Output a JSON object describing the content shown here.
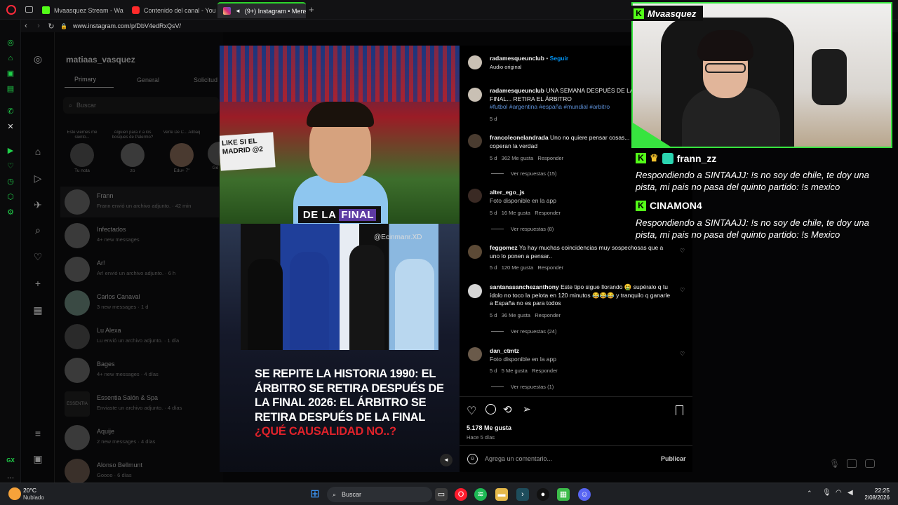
{
  "browser": {
    "tabs": [
      {
        "label": "Mvaasquez Stream - Watc",
        "color": "#53fc18"
      },
      {
        "label": "Contenido del canal - YouT",
        "color": "#ff2a2a"
      },
      {
        "label": "(9+) Instagram • Mens",
        "color": "#d6249f",
        "active": true
      }
    ],
    "url": "www.instagram.com/p/DbV4edRxQsV/",
    "new_tab": "+"
  },
  "inbox": {
    "username": "matiaas_vasquez",
    "tabs": [
      "Primary",
      "General",
      "Solicitud"
    ],
    "search_placeholder": "Buscar",
    "notes": [
      {
        "note": "Este viernes me siento...",
        "name": "Tu nota"
      },
      {
        "note": "Alguien para ir a los bosques de Palermo?",
        "name": "zo"
      },
      {
        "note": "Verte De C... Aitbaq",
        "name": "Edu+ 7\""
      },
      {
        "note": "",
        "name": "Ge"
      }
    ],
    "threads": [
      {
        "name": "Frann",
        "sub": "Frann envió un archivo adjunto. · 42 min"
      },
      {
        "name": "Infectados",
        "sub": "4+ new messages"
      },
      {
        "name": "Ar!",
        "sub": "Ar! envió un archivo adjunto. · 6 h"
      },
      {
        "name": "Carlos Canaval",
        "sub": "3 new messages · 1 d"
      },
      {
        "name": "Lu Alexa",
        "sub": "Lu envió un archivo adjunto. · 1 día"
      },
      {
        "name": "Bages",
        "sub": "4+ new messages · 4 días"
      },
      {
        "name": "Essentia Salón & Spa",
        "sub": "Enviaste un archivo adjunto. · 4 días"
      },
      {
        "name": "Aquije",
        "sub": "2 new messages · 4 días"
      },
      {
        "name": "Alonso Bellmunt",
        "sub": "Goooo · 6 días"
      }
    ]
  },
  "post": {
    "sign_text": "LIKE SI EL MADRID @2",
    "caption_left": "DE LA",
    "caption_right": "FINAL",
    "watermark": "@Ecinmanr.XD",
    "headline_white": "SE REPITE LA HISTORIA 1990: EL ÁRBITRO SE RETIRA DESPUÉS DE LA FINAL 2026: EL ÁRBITRO SE RETIRA DESPUÉS DE LA FINAL",
    "headline_red": "¿QUÉ CAUSALIDAD NO..?",
    "mute_icon": "speaker-icon"
  },
  "pane": {
    "author": "radamesqueunclub",
    "follow": "Seguir",
    "audio": "Audio original",
    "dot": "•",
    "caption_text": "UNA SEMANA DESPUÉS DE LA FINAL... RETIRA EL ÁRBITRO",
    "hashtags": "#futbol #argentina #españa #mundial #arbitro",
    "caption_time": "5 d",
    "comments": [
      {
        "user": "francoleonelandrada",
        "text": "Uno no quiere pensar cosas... pero no coperan la verdad",
        "time": "5 d",
        "likes": "362 Me gusta",
        "reply": "Responder",
        "replies": "Ver respuestas (15)"
      },
      {
        "user": "alter_ego_js",
        "text": "Foto disponible en la app",
        "time": "5 d",
        "likes": "16 Me gusta",
        "reply": "Responder",
        "replies": "Ver respuestas (8)"
      },
      {
        "user": "feggomez",
        "text": "Ya hay muchas coincidencias muy sospechosas que a uno lo ponen a pensar..",
        "time": "5 d",
        "likes": "120 Me gusta",
        "reply": "Responder",
        "replies": ""
      },
      {
        "user": "santanasanchezanthony",
        "text": "Este tipo sigue llorando 🤮 supéralo q tu ídolo no toco la pelota en 120 minutos 😂😂😂 y tranquilo q ganarle a España no es para todos",
        "time": "5 d",
        "likes": "36 Me gusta",
        "reply": "Responder",
        "replies": "Ver respuestas (24)"
      },
      {
        "user": "dan_ctmtz",
        "text": "Foto disponible en la app",
        "time": "5 d",
        "likes": "5 Me gusta",
        "reply": "Responder",
        "replies": "Ver respuestas (1)"
      }
    ],
    "likes_total": "5.178 Me gusta",
    "posted": "Hace 5 días",
    "comment_placeholder": "Agrega un comentario...",
    "publish": "Publicar"
  },
  "stream": {
    "channel": "Mvaasquez",
    "chat": [
      {
        "user": "frann_zz",
        "message": "Respondiendo a SINTAAJJ: !s no soy de chile, te doy una pista, mi pais no pasa del quinto partido:  !s mexico"
      },
      {
        "user": "CINAMON4",
        "message": "Respondiendo a SINTAAJJ: !s no soy de chile, te doy una pista, mi pais no pasa del quinto partido:  !s Mexico"
      }
    ]
  },
  "taskbar": {
    "weather_temp": "20°C",
    "weather_desc": "Nublado",
    "search": "Buscar",
    "time": "22:25",
    "date": "2/08/2026"
  },
  "colors": {
    "kick_green": "#53fc18",
    "ig_blue": "#0095f6",
    "link_blue": "#5c8fd6"
  }
}
